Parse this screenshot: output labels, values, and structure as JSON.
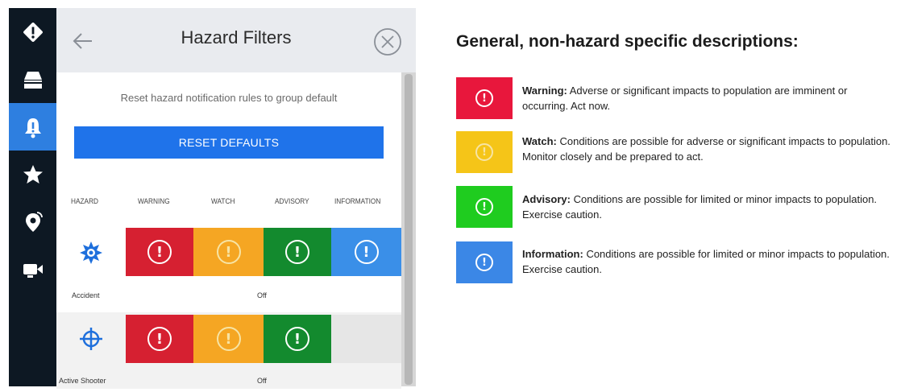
{
  "nav": {
    "items": [
      {
        "icon": "diamond-alert-icon",
        "active": false
      },
      {
        "icon": "inbox-tray-icon",
        "active": false
      },
      {
        "icon": "bell-alert-icon",
        "active": true
      },
      {
        "icon": "star-icon",
        "active": false
      },
      {
        "icon": "location-pin-icon",
        "active": false
      },
      {
        "icon": "video-camera-icon",
        "active": false
      }
    ]
  },
  "panel": {
    "title": "Hazard Filters",
    "reset_caption": "Reset hazard notification rules to group default",
    "reset_button": "RESET DEFAULTS",
    "columns": [
      "HAZARD",
      "WARNING",
      "WATCH",
      "ADVISORY",
      "INFORMATION"
    ],
    "rows": [
      {
        "name": "Accident",
        "icon": "gear-burst-icon",
        "status": "Off",
        "levels": [
          "warning",
          "watch",
          "advisory",
          "information"
        ]
      },
      {
        "name": "Active Shooter",
        "icon": "crosshair-icon",
        "status": "Off",
        "levels": [
          "warning",
          "watch",
          "advisory",
          "empty"
        ]
      }
    ]
  },
  "legend": {
    "title": "General, non-hazard specific descriptions:",
    "items": [
      {
        "term": "Warning:",
        "text": " Adverse or significant impacts to population are imminent or occurring. Act now.",
        "color": "#e8173c"
      },
      {
        "term": "Watch:",
        "text": " Conditions are possible for adverse or significant impacts to population. Monitor closely and be prepared to act.",
        "color": "#f5c518"
      },
      {
        "term": "Advisory:",
        "text": " Conditions are possible for limited or minor impacts to population. Exercise caution.",
        "color": "#1fcc1f"
      },
      {
        "term": "Information:",
        "text": " Conditions are possible for limited or minor impacts to population. Exercise caution.",
        "color": "#3b87e6"
      }
    ]
  },
  "colors": {
    "warning": "#d62031",
    "watch": "#f5a623",
    "advisory": "#138a2e",
    "information": "#3a8fe8",
    "accent": "#1f73ea",
    "rail": "#0d1823"
  }
}
